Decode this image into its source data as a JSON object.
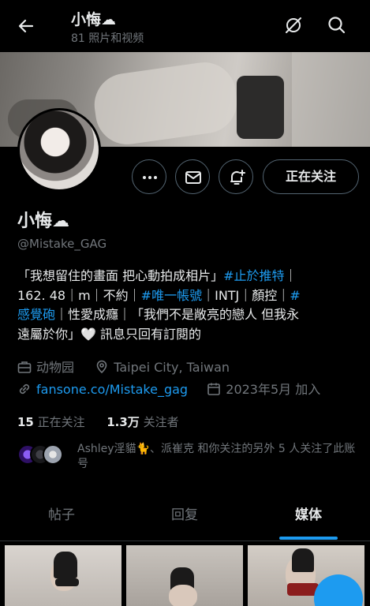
{
  "header": {
    "title": "小悔☁",
    "subtitle": "81 照片和视频"
  },
  "icons": {
    "back": "arrow-left-icon",
    "no_notify": "bell-off-icon",
    "search": "search-icon",
    "more": "more-icon",
    "message": "mail-icon",
    "subscribe": "bell-plus-icon"
  },
  "profile": {
    "name": "小悔☁",
    "handle": "@Mistake_GAG",
    "follow_button": "正在关注",
    "bio_lines": [
      [
        "「我想留住的畫面 把心動拍成相片」",
        "#止於推特",
        "｜"
      ],
      [
        "162. 48｜m｜不約｜",
        "#唯一帳號",
        "｜INTJ｜顏控｜",
        "#"
      ],
      [
        "感覺砲",
        "｜性愛成癮｜「我們不是敞亮的戀人 但我永"
      ],
      [
        "遠屬於你」🤍 訊息只回有訂閱的"
      ]
    ],
    "category": "动物园",
    "location": "Taipei City, Taiwan",
    "link": "fansone.co/Mistake_gag",
    "joined": "2023年5月 加入",
    "following_count": "15",
    "following_label": "正在关注",
    "followers_count": "1.3万",
    "followers_label": "关注者",
    "followed_by": "Ashley淫貓🐈、派崔克 和你关注的另外 5 人关注了此账号"
  },
  "tabs": [
    {
      "label": "帖子",
      "active": false
    },
    {
      "label": "回复",
      "active": false
    },
    {
      "label": "媒体",
      "active": true
    }
  ],
  "colors": {
    "accent": "#1d9bf0",
    "background": "#000000",
    "muted": "#71767b",
    "text": "#e7e9ea"
  }
}
